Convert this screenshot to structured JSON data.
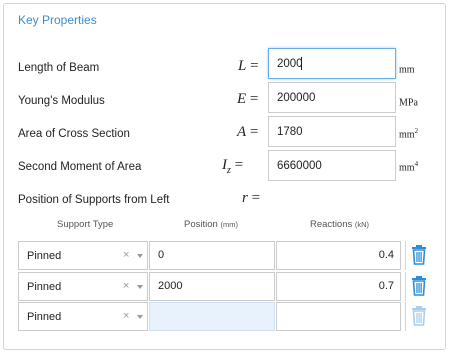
{
  "panel": {
    "title": "Key Properties"
  },
  "properties": [
    {
      "label": "Length of Beam",
      "symbol": "L",
      "subscript": "",
      "eq": "=",
      "value": "2000",
      "unit": "mm",
      "unit_sup": ""
    },
    {
      "label": "Young's Modulus",
      "symbol": "E",
      "subscript": "",
      "eq": "=",
      "value": "200000",
      "unit": "MPa",
      "unit_sup": ""
    },
    {
      "label": "Area of Cross Section",
      "symbol": "A",
      "subscript": "",
      "eq": "=",
      "value": "1780",
      "unit": "mm",
      "unit_sup": "2"
    },
    {
      "label": "Second Moment of Area",
      "symbol": "I",
      "subscript": "z",
      "eq": "=",
      "value": "6660000",
      "unit": "mm",
      "unit_sup": "4"
    }
  ],
  "supports": {
    "label": "Position of Supports from Left",
    "symbol": "r",
    "eq": "=",
    "headers": {
      "type": "Support Type",
      "position": "Position",
      "position_unit": "(mm)",
      "reactions": "Reactions",
      "reactions_unit": "(kN)"
    },
    "rows": [
      {
        "type": "Pinned",
        "clear": "×",
        "position": "0",
        "reaction": "0.4"
      },
      {
        "type": "Pinned",
        "clear": "×",
        "position": "2000",
        "reaction": "0.7"
      },
      {
        "type": "Pinned",
        "clear": "×",
        "position": "",
        "reaction": ""
      }
    ]
  },
  "colors": {
    "accent": "#3c8dcf",
    "trash": "#2b8fd8",
    "trash_disabled": "#a9cfee"
  },
  "icons": {
    "delete": "trash-icon",
    "dropdown": "chevron-down-icon",
    "clear": "clear-icon"
  }
}
